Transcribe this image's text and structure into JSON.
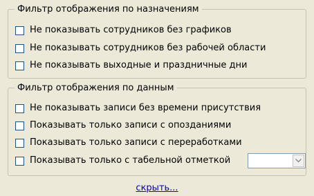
{
  "assignment_filter": {
    "title": "Фильтр отображения по назначениям",
    "options": [
      {
        "label": "Не показывать сотрудников без графиков",
        "checked": false
      },
      {
        "label": "Не показывать сотрудников без рабочей области",
        "checked": false
      },
      {
        "label": "Не показывать выходные и праздничные дни",
        "checked": false
      }
    ]
  },
  "data_filter": {
    "title": "Фильтр отображения по данным",
    "options": [
      {
        "label": "Не показывать записи без времени присутствия",
        "checked": false
      },
      {
        "label": "Показывать только записи с опозданиями",
        "checked": false
      },
      {
        "label": "Показывать только записи с переработками",
        "checked": false
      },
      {
        "label": "Показывать только с табельной отметкой",
        "checked": false
      }
    ],
    "timesheet_mark_select": {
      "value": "",
      "icon": "chevron-down-icon"
    }
  },
  "hide_link": "скрыть...",
  "colors": {
    "panel_bg": "#ece9d8",
    "group_border": "#c5c2b2",
    "checkbox_border": "#1c5180",
    "link": "#0000cc"
  }
}
